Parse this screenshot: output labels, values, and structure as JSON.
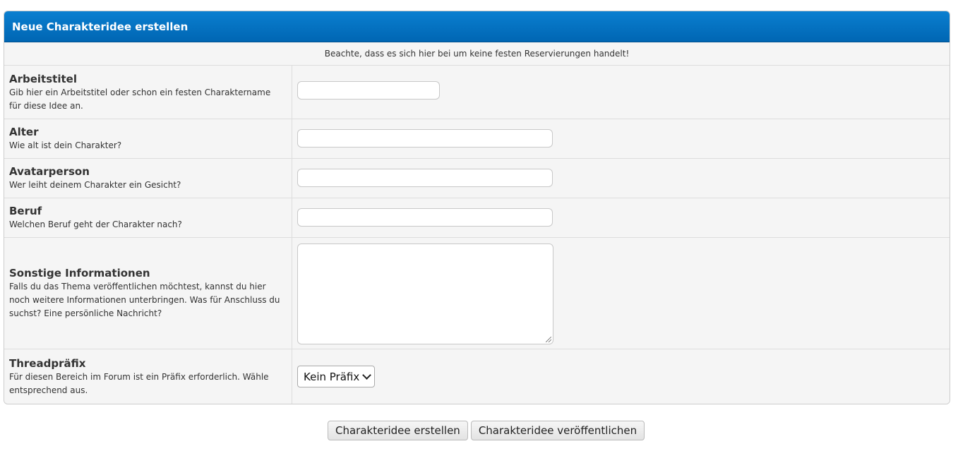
{
  "panel": {
    "title": "Neue Charakteridee erstellen",
    "notice": "Beachte, dass es sich hier bei um keine festen Reservierungen handelt!"
  },
  "fields": [
    {
      "title": "Arbeitstitel",
      "description": "Gib hier ein Arbeitstitel oder schon ein festen Charaktername für diese Idee an.",
      "value": ""
    },
    {
      "title": "Alter",
      "description": "Wie alt ist dein Charakter?",
      "value": ""
    },
    {
      "title": "Avatarperson",
      "description": "Wer leiht deinem Charakter ein Gesicht?",
      "value": ""
    },
    {
      "title": "Beruf",
      "description": "Welchen Beruf geht der Charakter nach?",
      "value": ""
    },
    {
      "title": "Sonstige Informationen",
      "description": "Falls du das Thema veröffentlichen möchtest, kannst du hier noch weitere Informationen unterbringen. Was für Anschluss du suchst? Eine persönliche Nachricht?",
      "value": ""
    },
    {
      "title": "Threadpräfix",
      "description": "Für diesen Bereich im Forum ist ein Präfix erforderlich. Wähle entsprechend aus.",
      "selected": "Kein Präfix"
    }
  ],
  "buttons": {
    "create": "Charakteridee erstellen",
    "publish": "Charakteridee veröffentlichen"
  }
}
